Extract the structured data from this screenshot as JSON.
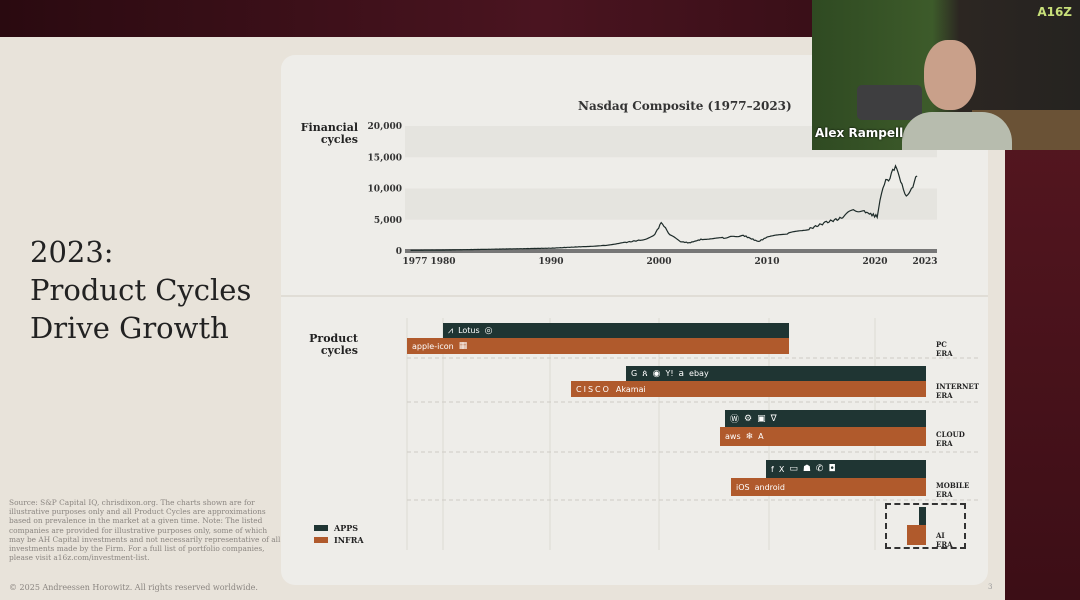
{
  "slide": {
    "title": "2023:\nProduct Cycles\nDrive Growth",
    "source": "Source: S&P Capital IQ, chrisdixon.org. The charts shown are for illustrative purposes only and all Product Cycles are approximations based on prevalence in the market at a given time. Note: The listed companies are provided for illustrative purposes only, some of which may be AH Capital investments and not necessarily representative of all investments made by the Firm. For a full list of portfolio companies, please visit a16z.com/investment-list.",
    "copyright": "© 2025 Andreessen Horowitz. All rights reserved worldwide.",
    "page_number": "3",
    "financial_label": "Financial cycles",
    "product_label": "Product cycles"
  },
  "chart_data": {
    "type": "line",
    "title": "Nasdaq Composite (1977–2023)",
    "xlabel": "",
    "ylabel": "",
    "ylim": [
      0,
      20000
    ],
    "xlim": [
      1977,
      2023
    ],
    "yticks": [
      "0",
      "5,000",
      "10,000",
      "15,000",
      "20,000"
    ],
    "xticks": [
      "1977",
      "1980",
      "1990",
      "2000",
      "2010",
      "2020",
      "2023"
    ],
    "series": [
      {
        "name": "Nasdaq Composite",
        "x": [
          1977,
          1980,
          1985,
          1990,
          1993,
          1995,
          1997,
          1998.5,
          1999.5,
          2000.2,
          2000.6,
          2001,
          2002,
          2002.8,
          2004,
          2006,
          2007.8,
          2009.2,
          2010,
          2012,
          2014,
          2015.5,
          2017,
          2018,
          2019,
          2020.2,
          2020.6,
          2021,
          2021.9,
          2022.5,
          2022.9,
          2023.5,
          2023.9
        ],
        "y": [
          100,
          150,
          300,
          450,
          700,
          900,
          1400,
          1800,
          2400,
          4400,
          3600,
          2600,
          1500,
          1300,
          1900,
          2100,
          2500,
          1500,
          2200,
          2800,
          3600,
          4600,
          5300,
          6700,
          6300,
          5500,
          9000,
          11000,
          13200,
          10500,
          9000,
          10500,
          12000
        ]
      }
    ],
    "grid": true
  },
  "product_cycles": {
    "eras": [
      {
        "name": "PC ERA",
        "apps": [
          "adobe-icon",
          "Lotus",
          "target-icon"
        ],
        "infra": [
          "apple-icon",
          "windows-icon"
        ]
      },
      {
        "name": "INTERNET ERA",
        "apps": [
          "G",
          "runner-icon",
          "circle-icon",
          "Y!",
          "amazon-icon",
          "ebay"
        ],
        "infra": [
          "CISCO",
          "Akamai"
        ]
      },
      {
        "name": "CLOUD ERA",
        "apps": [
          "workday-icon",
          "hubspot-icon",
          "shopify-icon",
          "veeva-icon"
        ],
        "infra": [
          "aws",
          "snowflake-icon",
          "A"
        ]
      },
      {
        "name": "MOBILE ERA",
        "apps": [
          "f",
          "X",
          "uber-icon",
          "snapchat-icon",
          "whatsapp-icon",
          "instagram-icon"
        ],
        "infra": [
          "iOS",
          "android"
        ]
      },
      {
        "name": "AI ERA",
        "apps": [],
        "infra": []
      }
    ],
    "legend": {
      "apps": "APPS",
      "infra": "INFRA"
    },
    "colors": {
      "apps": "#1f3533",
      "infra": "#b05a2c"
    }
  },
  "video": {
    "speaker": "Alex Rampell",
    "logo": "A16Z"
  }
}
